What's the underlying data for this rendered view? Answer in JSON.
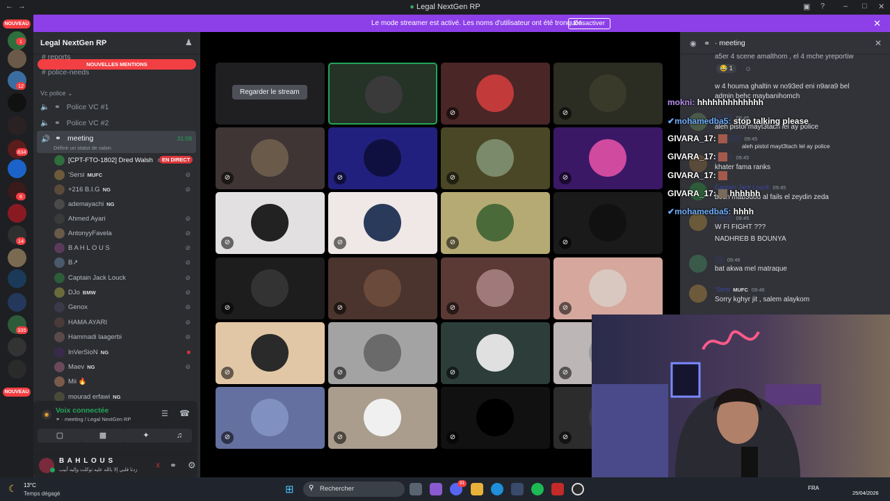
{
  "window": {
    "title": "Legal NextGen RP"
  },
  "banner": {
    "message": "Le mode streamer est activé. Les noms d'utilisateur ont été tronqués.",
    "button": "Désactiver"
  },
  "servers": {
    "new_label": "NOUVEAU",
    "badges": [
      "1",
      "12",
      "834",
      "6",
      "14",
      "335"
    ]
  },
  "sidebar": {
    "guild_name": "Legal NextGen RP",
    "new_mentions": "NOUVELLES MENTIONS",
    "channels_top": [
      "reports",
      "police-needs"
    ],
    "category": "Vc police",
    "voice_channels": [
      "Police VC #1",
      "Police VC #2"
    ],
    "meeting": {
      "name": "meeting",
      "timer": "31:09",
      "status_hint": "Définir un statut de salon"
    },
    "members": [
      {
        "name": "[CPT-FTO-1802] Dred Walsh",
        "count": "6",
        "badge": "EN DIRECT"
      },
      {
        "name": "'Sersi",
        "tag": "MUFC"
      },
      {
        "name": "+216 B.I.G",
        "tag": "NG"
      },
      {
        "name": "ademayachi",
        "tag": "NG"
      },
      {
        "name": "Ahmed Ayari"
      },
      {
        "name": "AntonyyFavela"
      },
      {
        "name": "B A H L O U S"
      },
      {
        "name": "B↗"
      },
      {
        "name": "Captain Jack Louck"
      },
      {
        "name": "DJo",
        "tag": "BMW"
      },
      {
        "name": "Genox"
      },
      {
        "name": "HAMA AYARI"
      },
      {
        "name": "Hammadi laagerbi"
      },
      {
        "name": "InVerSioN",
        "tag": "NG"
      },
      {
        "name": "Maev",
        "tag": "NG"
      },
      {
        "name": "Mii 🔥"
      },
      {
        "name": "mourad erfawi",
        "tag": "NG"
      }
    ],
    "voice": {
      "status": "Voix connectée",
      "location": "meeting / Legal NextGen RP"
    },
    "user": {
      "name": "B A H L O U S",
      "status": "زدنا قلبي إلا بالله عليه توكلت وإليه أنيب"
    }
  },
  "stage": {
    "stream_button": "Regarder le stream",
    "tile_colors": [
      "#1f1f22",
      "#243326",
      "#4a2626",
      "#2b2c22",
      "#3f3535",
      "#22207e",
      "#4a4727",
      "#3b1866",
      "#e2e0e0",
      "#efe8e6",
      "#b5aa73",
      "#1a1a1a",
      "#1d1d1d",
      "#4b342d",
      "#5b3a36",
      "#d5a79d",
      "#e2c7a6",
      "#a3a3a3",
      "#2d3e3a",
      "#bdb6b6",
      "#6470a0",
      "#ab9d8d",
      "#111111",
      "#2c2c2c"
    ]
  },
  "chat": {
    "channel": "meeting",
    "messages": [
      {
        "text": "a5er 4 scene amalthom , el 4 mche yreportiw"
      },
      {
        "reaction": "1"
      },
      {
        "text": "w 4 houma ghaltin w no93ed eni n9ara9 bel"
      },
      {
        "text": "admin behc maybanihomch"
      },
      {
        "user": "░░░░",
        "time": "09:45",
        "text": "aleh pistol mayt3tach lel ay police"
      },
      {
        "user": "░░░░",
        "time": "09:45",
        "text": "aleh pistol mayt3tach lel ay police"
      },
      {
        "user": "░░░░",
        "time": "09:45",
        "text": "khater fama ranks"
      },
      {
        "user": "Captain Jack Louck",
        "time": "09:45",
        "text": "becn mab3dou al fails el zeydin zeda"
      },
      {
        "user": "░░░░",
        "time": "09:45",
        "text": "W FI FIGHT ???"
      },
      {
        "text": "NADHREB B BOUNYA"
      },
      {
        "user": "░░",
        "time": "09:46",
        "text": "bat akwa mel matraque"
      },
      {
        "user": "'Sersi",
        "tag": "MUFC",
        "time": "09:46",
        "text": "Sorry kghyr jit , salem alaykom"
      }
    ]
  },
  "overlay_chat": [
    {
      "user": "mokni:",
      "text": "hhhhhhhhhhhhh",
      "color": "#b98ef0"
    },
    {
      "user": "mohamedba5:",
      "text": "stop talking please",
      "color": "#6fb0ff"
    },
    {
      "user": "GIVARA_17:",
      "text": "",
      "color": "#ffffff"
    },
    {
      "user": "GIVARA_17:",
      "text": "",
      "color": "#ffffff"
    },
    {
      "user": "GIVARA_17:",
      "text": "",
      "color": "#ffffff"
    },
    {
      "user": "GIVARA_17:",
      "text": "hhhhhh",
      "color": "#ffffff"
    },
    {
      "user": "mohamedba5:",
      "text": "hhhh",
      "color": "#6fb0ff"
    }
  ],
  "taskbar": {
    "weather_temp": "13°C",
    "weather_desc": "Temps dégagé",
    "search": "Rechercher",
    "lang": "FRA",
    "date": "25/04/2026",
    "discord_badge": "91"
  },
  "colors": {
    "accent": "#5865f2",
    "banner": "#8d3fe8",
    "live": "#da373c",
    "online": "#23a55a"
  }
}
